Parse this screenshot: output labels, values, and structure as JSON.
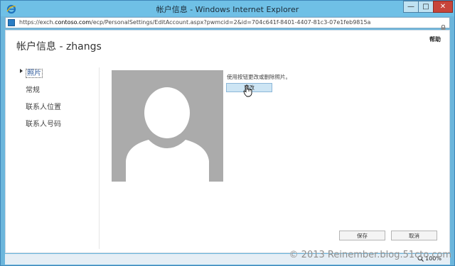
{
  "window": {
    "title": "帐户信息 - Windows Internet Explorer",
    "controls": {
      "minimize": "—",
      "maximize": "□",
      "close": "✕"
    }
  },
  "address_bar": {
    "url_prefix": "https://exch.",
    "url_host": "contoso.com",
    "url_rest": "/ecp/PersonalSettings/EditAccount.aspx?pwmcid=2&id=704c641f-8401-4407-81c3-07e1feb9815a"
  },
  "page": {
    "title": "帐户信息 - zhangs",
    "help": "帮助"
  },
  "nav": {
    "items": [
      {
        "label": "照片",
        "selected": true
      },
      {
        "label": "常规",
        "selected": false
      },
      {
        "label": "联系人位置",
        "selected": false
      },
      {
        "label": "联系人号码",
        "selected": false
      }
    ]
  },
  "photo_section": {
    "instructions": "使用按钮更改或删除照片。",
    "change_button": "更改"
  },
  "footer": {
    "save": "保存",
    "cancel": "取消"
  },
  "status_bar": {
    "zoom": "100%"
  },
  "watermark": "© 2013 Reinember.blog.51cto.com",
  "colors": {
    "titlebar": "#6fc0e6",
    "accent": "#2b579a",
    "photo_bg": "#ababab",
    "close_button": "#c7453a"
  }
}
